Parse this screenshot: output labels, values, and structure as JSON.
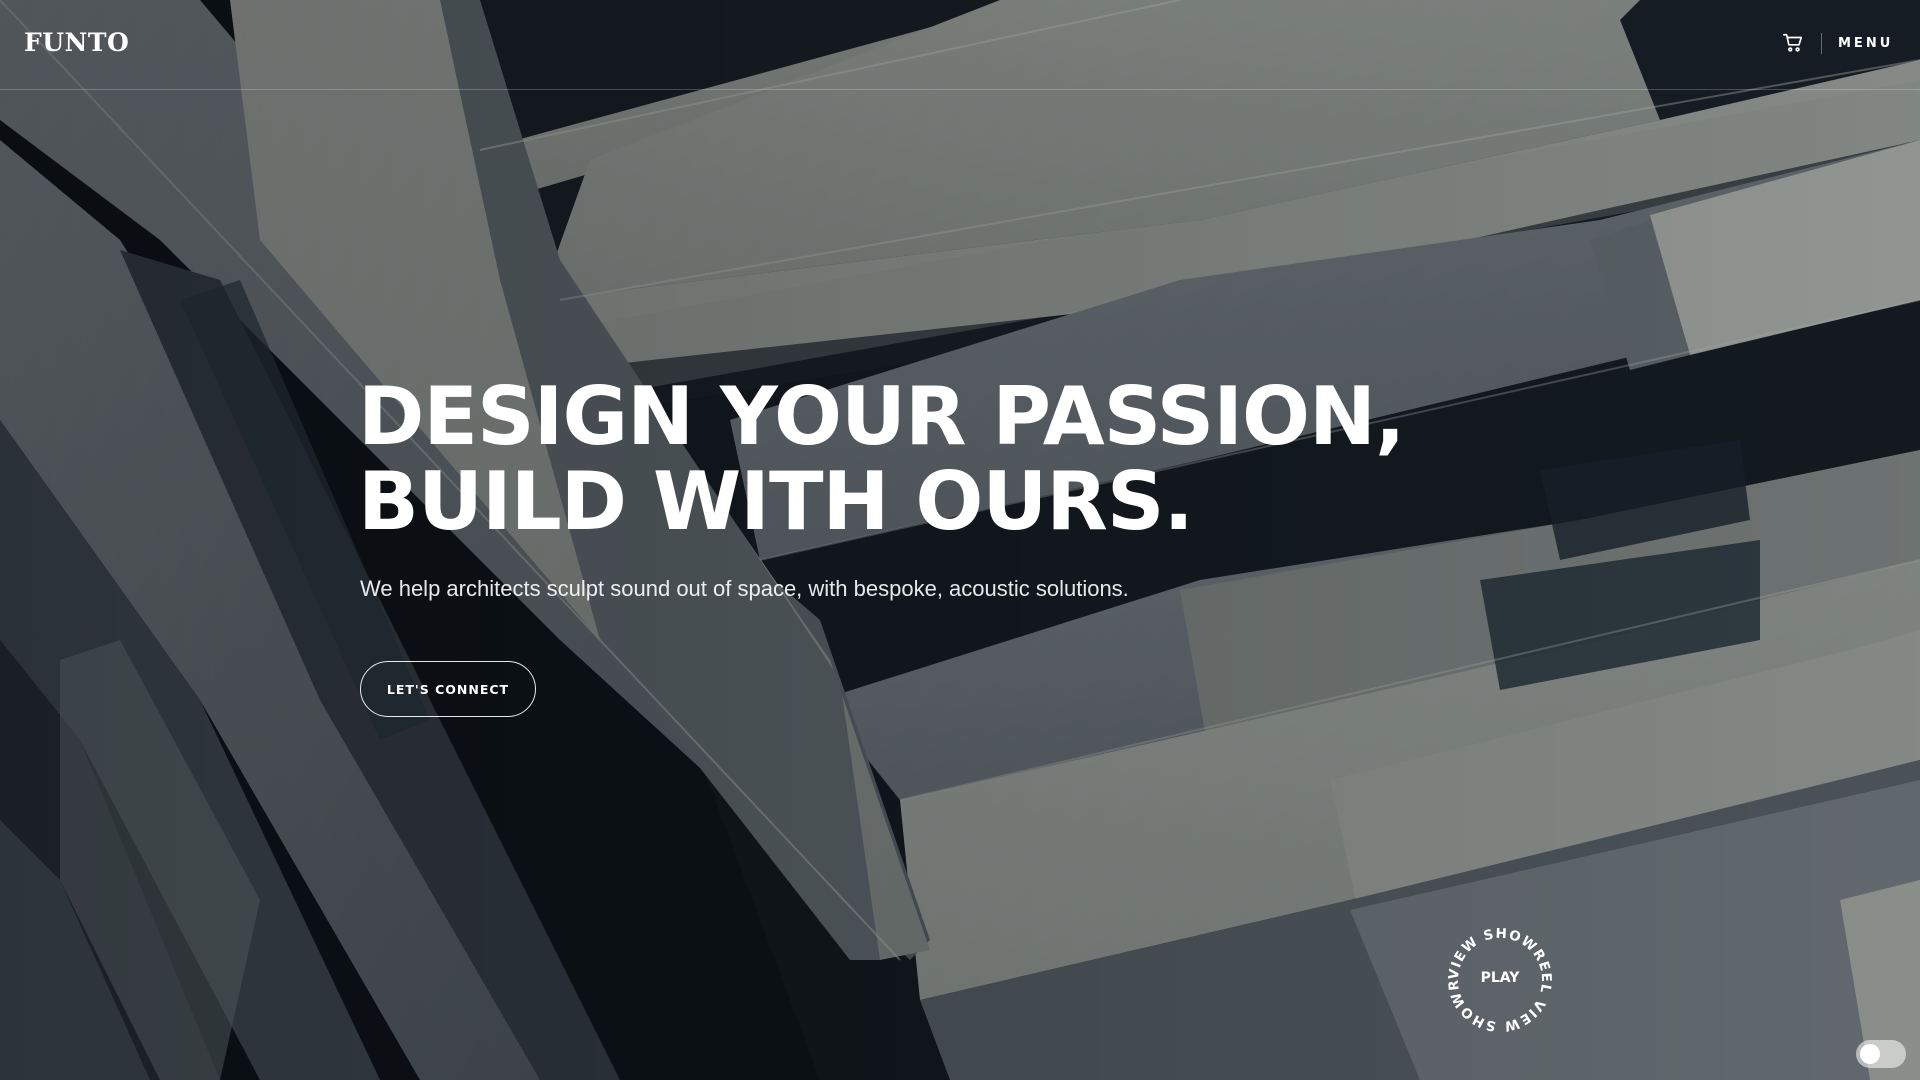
{
  "header": {
    "logo": "FUNTO",
    "cart_icon": "cart-icon",
    "menu_label": "MENU"
  },
  "hero": {
    "headline_line1": "DESIGN YOUR PASSION,",
    "headline_line2": "BUILD WITH OURS.",
    "subtitle": "We help architects sculpt sound out of space, with bespoke, acoustic solutions.",
    "cta_label": "LET'S CONNECT",
    "background": "architectural-facade-photo"
  },
  "showreel": {
    "ring_text": "VIEW SHOWREEL VIEW SHOWREEL ",
    "play_label": "PLAY"
  },
  "theme_toggle": {
    "icon": "theme-toggle"
  }
}
